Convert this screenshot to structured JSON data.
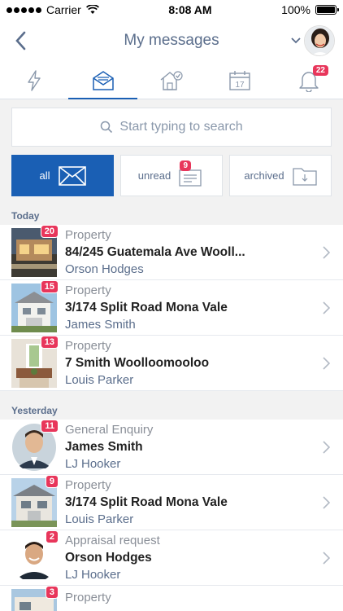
{
  "status": {
    "carrier": "Carrier",
    "time": "8:08 AM",
    "battery": "100%"
  },
  "header": {
    "title": "My messages"
  },
  "tabs": [
    {
      "icon": "lightning-icon"
    },
    {
      "icon": "envelope-icon",
      "active": true
    },
    {
      "icon": "house-check-icon"
    },
    {
      "icon": "calendar-icon",
      "day": "17"
    },
    {
      "icon": "bell-icon",
      "badge": "22"
    }
  ],
  "search": {
    "placeholder": "Start typing to search"
  },
  "filters": {
    "all": "all",
    "unread": "unread",
    "unread_badge": "9",
    "archived": "archived"
  },
  "sections": {
    "today": "Today",
    "yesterday": "Yesterday"
  },
  "today": [
    {
      "badge": "20",
      "type": "Property",
      "title": "84/245 Guatemala Ave Wooll...",
      "sub": "Orson Hodges"
    },
    {
      "badge": "15",
      "type": "Property",
      "title": "3/174 Split Road Mona Vale",
      "sub": "James Smith"
    },
    {
      "badge": "13",
      "type": "Property",
      "title": "7 Smith Woolloomooloo",
      "sub": "Louis Parker"
    }
  ],
  "yesterday": [
    {
      "badge": "11",
      "type": "General Enquiry",
      "title": "James Smith",
      "sub": "LJ Hooker"
    },
    {
      "badge": "9",
      "type": "Property",
      "title": "3/174 Split Road Mona Vale",
      "sub": "Louis Parker"
    },
    {
      "badge": "2",
      "type": "Appraisal request",
      "title": "Orson Hodges",
      "sub": "LJ Hooker"
    },
    {
      "badge": "3",
      "type": "Property"
    }
  ],
  "colors": {
    "accent": "#1a5fb4",
    "badge": "#e8365b",
    "title": "#5b6e8c"
  }
}
